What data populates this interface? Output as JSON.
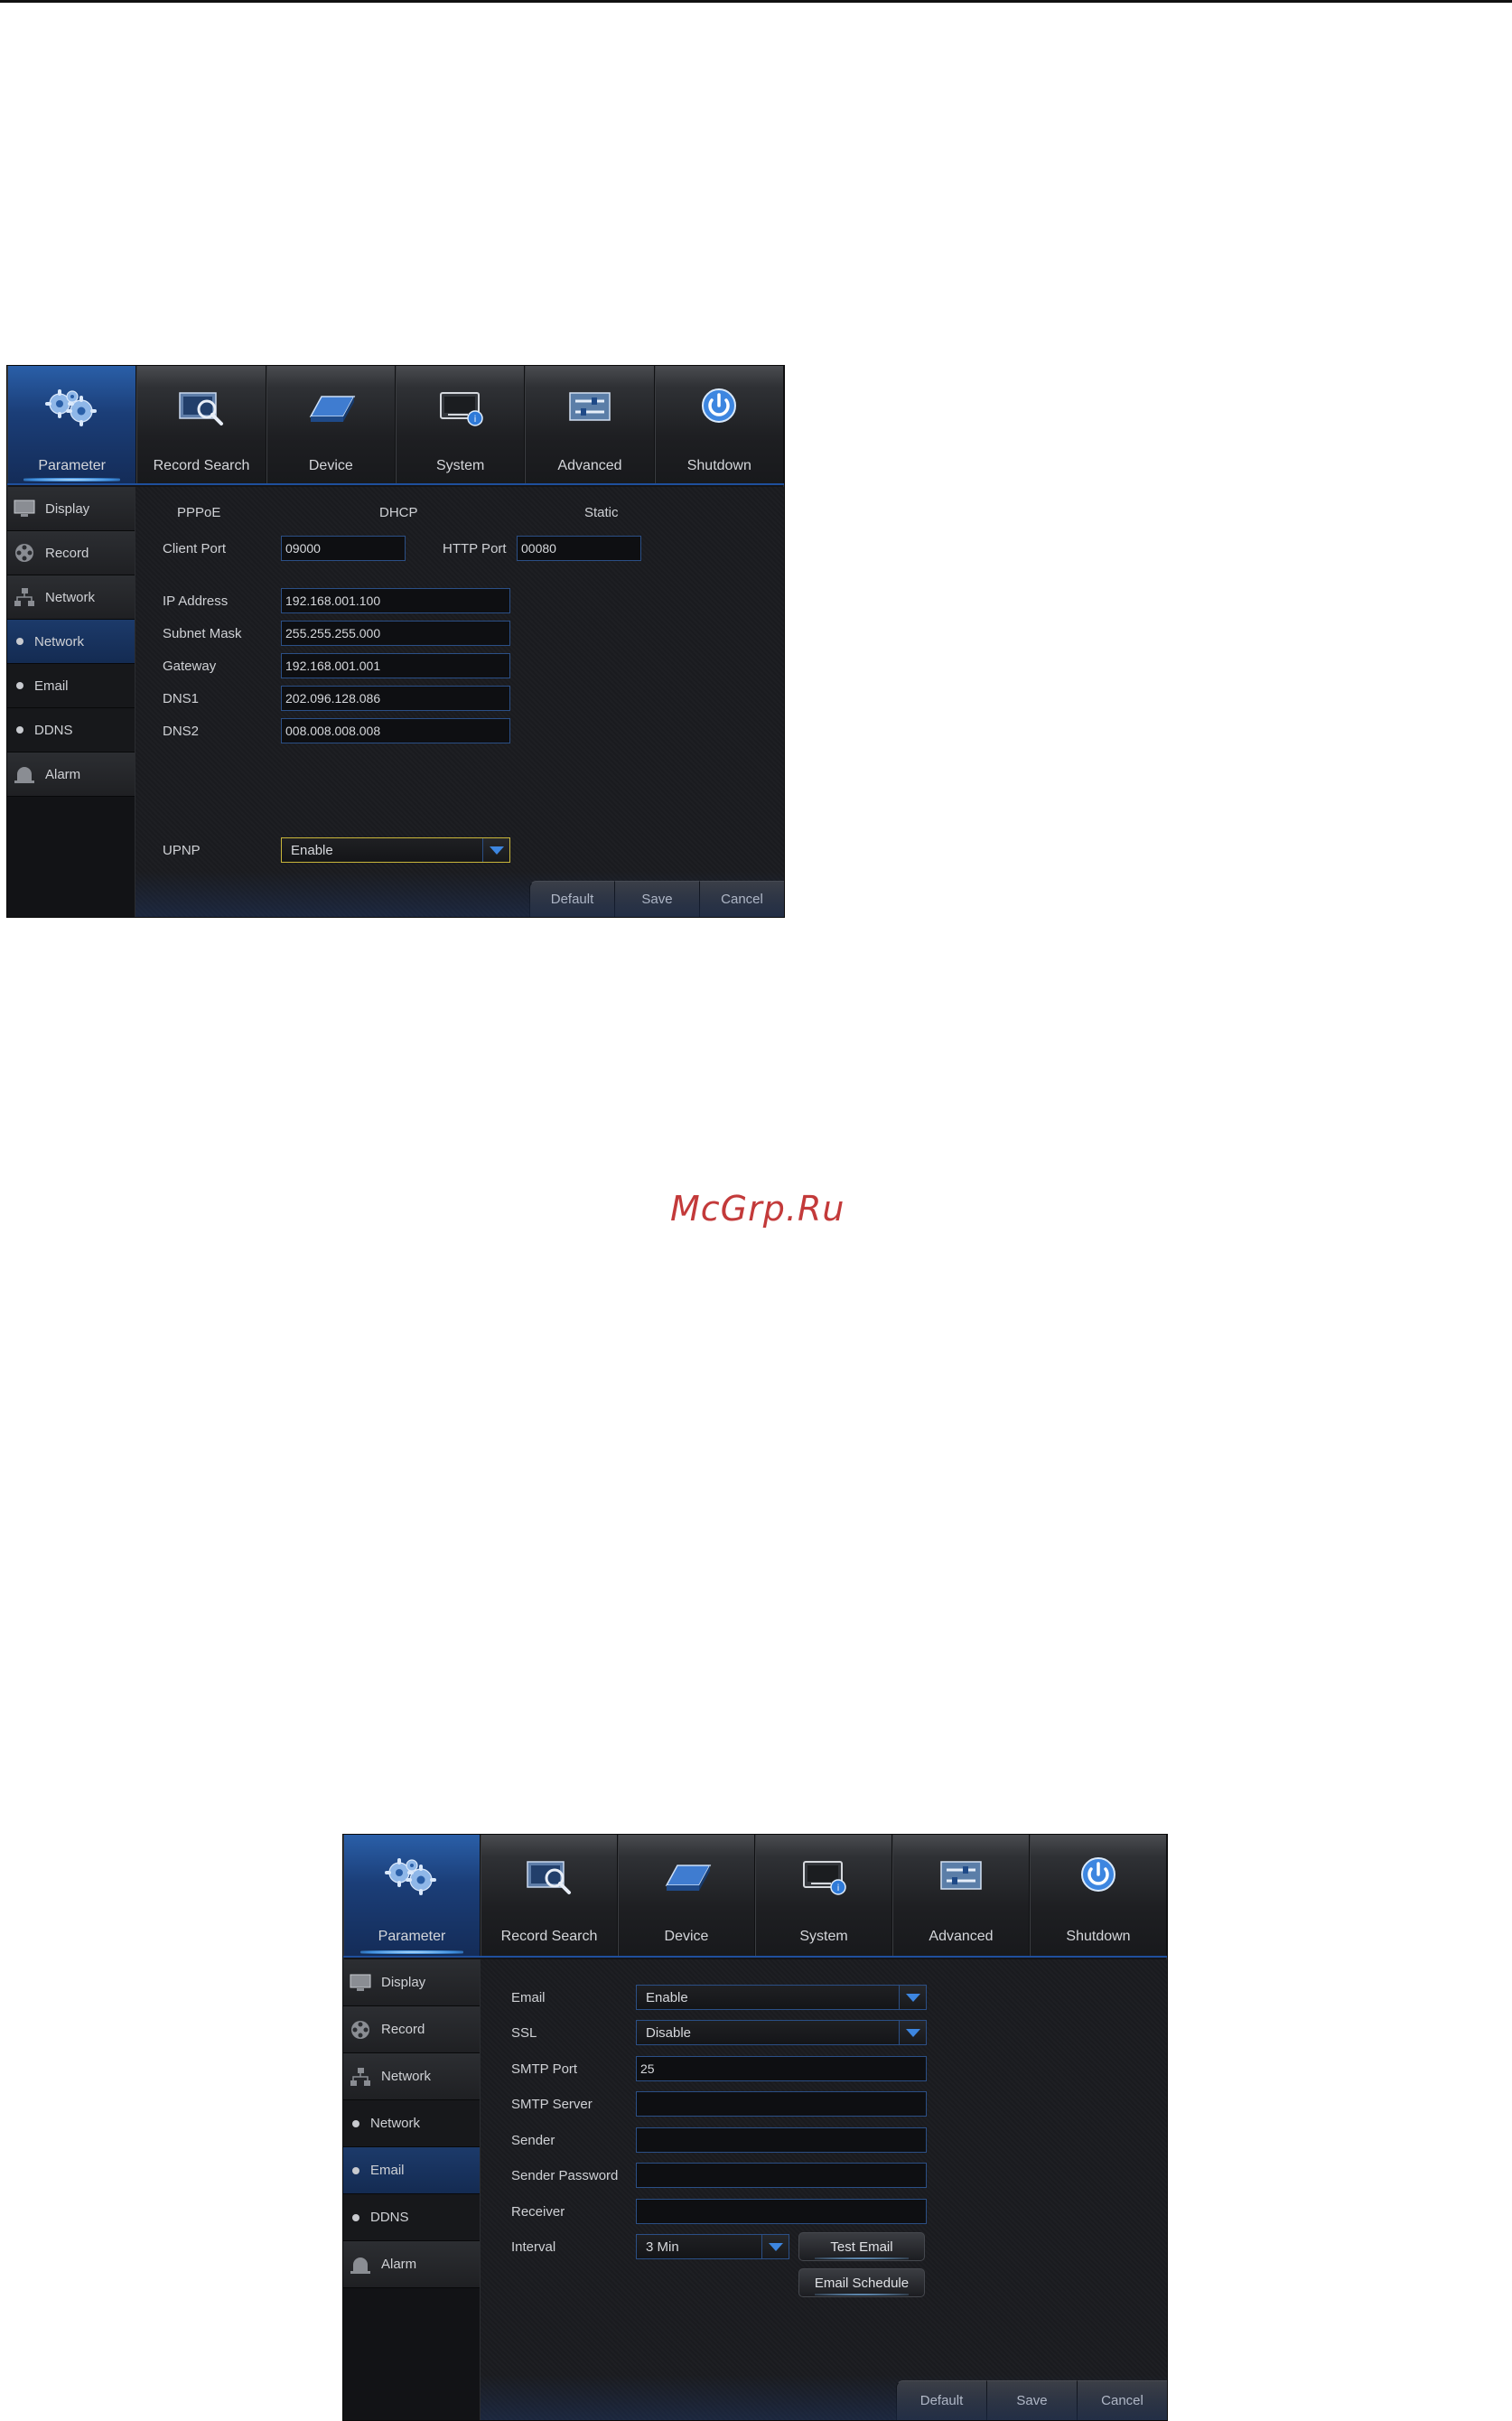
{
  "watermark": "McGrp.Ru",
  "colors": {
    "accent_blue": "#1f4f9c",
    "highlight_yellow": "#c9b63a",
    "panel_bg": "#1a1b1f",
    "watermark_red": "#c33a3a"
  },
  "tabs": [
    {
      "label": "Parameter",
      "icon": "gears-icon"
    },
    {
      "label": "Record Search",
      "icon": "record-search-icon"
    },
    {
      "label": "Device",
      "icon": "hard-drive-icon"
    },
    {
      "label": "System",
      "icon": "system-monitor-icon"
    },
    {
      "label": "Advanced",
      "icon": "advanced-sliders-icon"
    },
    {
      "label": "Shutdown",
      "icon": "power-icon"
    }
  ],
  "sidebar": {
    "display": "Display",
    "record": "Record",
    "network": "Network",
    "sub_network": "Network",
    "sub_email": "Email",
    "sub_ddns": "DDNS",
    "alarm": "Alarm"
  },
  "buttons": {
    "default": "Default",
    "save": "Save",
    "cancel": "Cancel"
  },
  "network_screen": {
    "mode_pppoe": "PPPoE",
    "mode_dhcp": "DHCP",
    "mode_static": "Static",
    "client_port_label": "Client Port",
    "client_port_value": "09000",
    "http_port_label": "HTTP Port",
    "http_port_value": "00080",
    "ip_address_label": "IP Address",
    "ip_address_value": "192.168.001.100",
    "subnet_mask_label": "Subnet Mask",
    "subnet_mask_value": "255.255.255.000",
    "gateway_label": "Gateway",
    "gateway_value": "192.168.001.001",
    "dns1_label": "DNS1",
    "dns1_value": "202.096.128.086",
    "dns2_label": "DNS2",
    "dns2_value": "008.008.008.008",
    "upnp_label": "UPNP",
    "upnp_value": "Enable"
  },
  "email_screen": {
    "email_label": "Email",
    "email_value": "Enable",
    "ssl_label": "SSL",
    "ssl_value": "Disable",
    "smtp_port_label": "SMTP Port",
    "smtp_port_value": "25",
    "smtp_server_label": "SMTP Server",
    "smtp_server_value": "",
    "sender_label": "Sender",
    "sender_value": "",
    "sender_password_label": "Sender Password",
    "sender_password_value": "",
    "receiver_label": "Receiver",
    "receiver_value": "",
    "interval_label": "Interval",
    "interval_value": "3 Min",
    "test_email_button": "Test Email",
    "email_schedule_button": "Email Schedule"
  }
}
